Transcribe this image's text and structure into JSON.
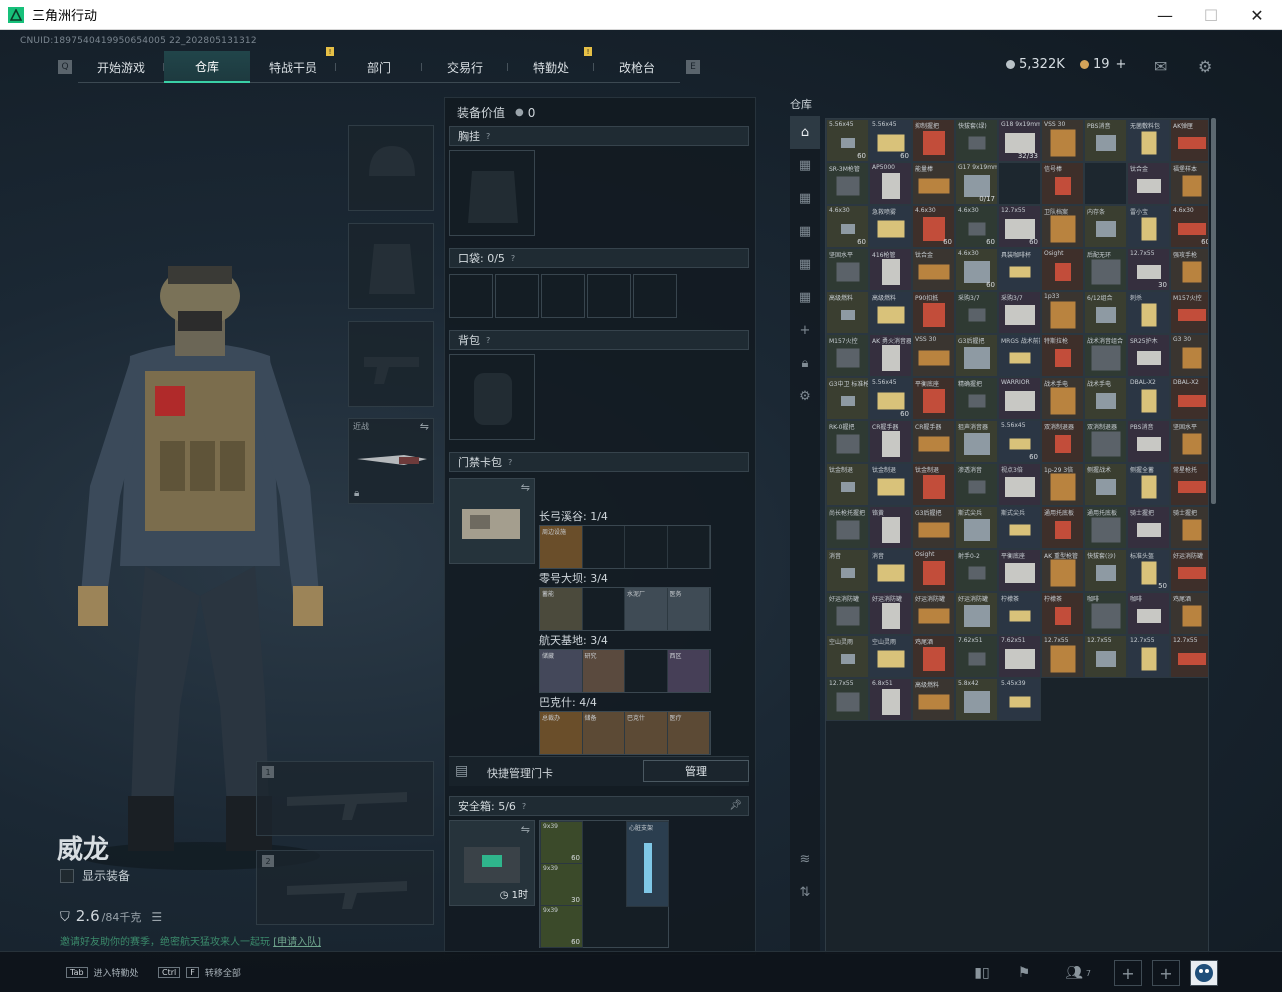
{
  "window": {
    "title": "三角洲行动",
    "minimize": "—",
    "maximize": "☐",
    "close": "✕"
  },
  "uid": "CNUID:1897540419950654005 22_202805131312",
  "nav": {
    "tabs": [
      "开始游戏",
      "仓库",
      "特战干员",
      "部门",
      "交易行",
      "特勤处",
      "改枪台"
    ],
    "active": "仓库"
  },
  "currency": {
    "coins": "5,322K",
    "tickets": "19",
    "plus": "+"
  },
  "character": {
    "name": "威龙",
    "show_equipment": "显示装备",
    "weight_value": "2.6",
    "weight_unit": "/84千克",
    "notice_text": "邀请好友助你的赛季，绝密航天猛攻来人一起玩",
    "notice_link": "[申请入队]",
    "melee_label": "近战"
  },
  "weapon_slots": [
    "1",
    "2"
  ],
  "middle": {
    "equip_value_label": "装备价值",
    "equip_value": "0",
    "chest_rig": "胸挂",
    "pockets": "口袋: 0/5",
    "backpack": "背包",
    "keycard_case": "门禁卡包",
    "keycard_rows": [
      {
        "label": "长弓溪谷: 1/4",
        "cards": [
          "周边设施"
        ]
      },
      {
        "label": "零号大坝: 3/4",
        "cards": [
          "蓄能",
          "",
          "水泥厂",
          "医务"
        ]
      },
      {
        "label": "航天基地: 3/4",
        "cards": [
          "储藏",
          "研究",
          "",
          "西区"
        ]
      },
      {
        "label": "巴克什: 4/4",
        "cards": [
          "总裁办",
          "储备",
          "巴克什",
          "医疗"
        ]
      }
    ],
    "quick_manage": "快捷管理门卡",
    "manage_button": "管理",
    "safe_box": "安全箱: 5/6",
    "safe_timer": "1时",
    "safe_items": [
      {
        "label": "9x39",
        "count": "60"
      },
      {
        "label": "9x39",
        "count": "30"
      },
      {
        "label": "9x39",
        "count": "60"
      },
      {
        "label": "心脏支架"
      }
    ]
  },
  "storage": {
    "label": "仓库",
    "items": [
      {
        "t": "5.56x45",
        "n": "60"
      },
      {
        "t": "5.56x45",
        "n": "60"
      },
      {
        "t": "抑制握把",
        "n": ""
      },
      {
        "t": "快拔套(绿)",
        "n": ""
      },
      {
        "t": "G18 9x19mm",
        "n": "32/33"
      },
      {
        "t": "VSS 30",
        "n": ""
      },
      {
        "t": "PBS消音",
        "n": ""
      },
      {
        "t": "无菌敷料包",
        "n": ""
      },
      {
        "t": "AK弹匣",
        "n": ""
      },
      {
        "t": "SR-3M枪管",
        "n": ""
      },
      {
        "t": "AP5000",
        "n": ""
      },
      {
        "t": "能量棒",
        "n": ""
      },
      {
        "t": "G17 9x19mm",
        "n": "0/17"
      },
      {
        "t": "",
        "n": ""
      },
      {
        "t": "信号棒",
        "n": ""
      },
      {
        "t": "",
        "n": ""
      },
      {
        "t": "钛合金",
        "n": ""
      },
      {
        "t": "福堡样本",
        "n": ""
      },
      {
        "t": "4.6x30",
        "n": "60"
      },
      {
        "t": "急救喷雾",
        "n": ""
      },
      {
        "t": "4.6x30",
        "n": "60"
      },
      {
        "t": "4.6x30",
        "n": "60"
      },
      {
        "t": "12.7x55",
        "n": "60"
      },
      {
        "t": "卫队档案",
        "n": ""
      },
      {
        "t": "内存条",
        "n": ""
      },
      {
        "t": "雷小宝",
        "n": ""
      },
      {
        "t": "4.6x30",
        "n": "60"
      },
      {
        "t": "坚固水平",
        "n": ""
      },
      {
        "t": "416枪管",
        "n": ""
      },
      {
        "t": "钛合金",
        "n": ""
      },
      {
        "t": "4.6x30",
        "n": "60"
      },
      {
        "t": "具装咖啡杯",
        "n": ""
      },
      {
        "t": "Osight",
        "n": ""
      },
      {
        "t": "后配无环",
        "n": ""
      },
      {
        "t": "12.7x55",
        "n": "30"
      },
      {
        "t": "强攻手枪",
        "n": ""
      },
      {
        "t": "高级燃料",
        "n": ""
      },
      {
        "t": "高级燃料",
        "n": ""
      },
      {
        "t": "P90扣抵",
        "n": ""
      },
      {
        "t": "采购3/7",
        "n": ""
      },
      {
        "t": "采购3/7",
        "n": ""
      },
      {
        "t": "1p33",
        "n": ""
      },
      {
        "t": "6/12组合",
        "n": ""
      },
      {
        "t": "刺杀",
        "n": ""
      },
      {
        "t": "M157火控",
        "n": ""
      },
      {
        "t": "M157火控",
        "n": ""
      },
      {
        "t": "AK 勇火消音器",
        "n": ""
      },
      {
        "t": "VSS 30",
        "n": ""
      },
      {
        "t": "G3后握把",
        "n": ""
      },
      {
        "t": "MRGS 战术前握",
        "n": ""
      },
      {
        "t": "特斯拉枪",
        "n": ""
      },
      {
        "t": "战术消音组合",
        "n": ""
      },
      {
        "t": "SR25护木",
        "n": ""
      },
      {
        "t": "G3 30",
        "n": ""
      },
      {
        "t": "G3中卫 标准枪管",
        "n": ""
      },
      {
        "t": "5.56x45",
        "n": "60"
      },
      {
        "t": "平衡底座",
        "n": ""
      },
      {
        "t": "精确握把",
        "n": ""
      },
      {
        "t": "WARRIOR",
        "n": ""
      },
      {
        "t": "战术手电",
        "n": ""
      },
      {
        "t": "战术手电",
        "n": ""
      },
      {
        "t": "DBAL-X2",
        "n": ""
      },
      {
        "t": "DBAL-X2",
        "n": ""
      },
      {
        "t": "RK-0握把",
        "n": ""
      },
      {
        "t": "CR握手器",
        "n": ""
      },
      {
        "t": "CR握手器",
        "n": ""
      },
      {
        "t": "狙声消音器",
        "n": ""
      },
      {
        "t": "5.56x45",
        "n": "60"
      },
      {
        "t": "双消制退器",
        "n": ""
      },
      {
        "t": "双消制退器",
        "n": ""
      },
      {
        "t": "PBS消音",
        "n": ""
      },
      {
        "t": "坚固水平",
        "n": ""
      },
      {
        "t": "钛金制退",
        "n": ""
      },
      {
        "t": "钛金制退",
        "n": ""
      },
      {
        "t": "钛金制退",
        "n": ""
      },
      {
        "t": "渗透消音",
        "n": ""
      },
      {
        "t": "视点3倍",
        "n": ""
      },
      {
        "t": "1p-29 3倍",
        "n": ""
      },
      {
        "t": "侧握战术",
        "n": ""
      },
      {
        "t": "侧握全蓄",
        "n": ""
      },
      {
        "t": "常星枪托",
        "n": ""
      },
      {
        "t": "尚长枪托握把",
        "n": ""
      },
      {
        "t": "铬黄",
        "n": ""
      },
      {
        "t": "G3后握把",
        "n": ""
      },
      {
        "t": "斯式尖兵",
        "n": ""
      },
      {
        "t": "斯式尖兵",
        "n": ""
      },
      {
        "t": "通用托底板",
        "n": ""
      },
      {
        "t": "通用托底板",
        "n": ""
      },
      {
        "t": "骑士握把",
        "n": ""
      },
      {
        "t": "骑士握把",
        "n": ""
      },
      {
        "t": "消音",
        "n": ""
      },
      {
        "t": "消音",
        "n": ""
      },
      {
        "t": "Osight",
        "n": ""
      },
      {
        "t": "射手0-2",
        "n": ""
      },
      {
        "t": "平衡底座",
        "n": ""
      },
      {
        "t": "AK 重型枪管",
        "n": ""
      },
      {
        "t": "快拔套(沙)",
        "n": ""
      },
      {
        "t": "标准头盔",
        "n": "50"
      },
      {
        "t": "好运消防罐",
        "n": ""
      },
      {
        "t": "好运消防罐",
        "n": ""
      },
      {
        "t": "好运消防罐",
        "n": ""
      },
      {
        "t": "好运消防罐",
        "n": ""
      },
      {
        "t": "好运消防罐",
        "n": ""
      },
      {
        "t": "柠檬茶",
        "n": ""
      },
      {
        "t": "柠檬茶",
        "n": ""
      },
      {
        "t": "咖啡",
        "n": ""
      },
      {
        "t": "咖啡",
        "n": ""
      },
      {
        "t": "鸡尾酒",
        "n": ""
      },
      {
        "t": "空山灵雨",
        "n": ""
      },
      {
        "t": "空山灵雨",
        "n": ""
      },
      {
        "t": "鸡尾酒",
        "n": ""
      },
      {
        "t": "7.62x51",
        "n": ""
      },
      {
        "t": "7.62x51",
        "n": ""
      },
      {
        "t": "12.7x55",
        "n": ""
      },
      {
        "t": "12.7x55",
        "n": ""
      },
      {
        "t": "12.7x55",
        "n": ""
      },
      {
        "t": "12.7x55",
        "n": ""
      },
      {
        "t": "12.7x55",
        "n": ""
      },
      {
        "t": "6.8x51",
        "n": ""
      },
      {
        "t": "高级燃料",
        "n": ""
      },
      {
        "t": "5.8x42",
        "n": ""
      },
      {
        "t": "5.45x39",
        "n": ""
      }
    ]
  },
  "bottom": {
    "hint1_key": "Tab",
    "hint1": "进入特勤处",
    "hint2_key": "Ctrl",
    "hint2_key2": "F",
    "hint2": "转移全部",
    "friends_count": "7"
  },
  "colors": {
    "accent": "#3ad0a6",
    "gold": "#e6c046"
  }
}
